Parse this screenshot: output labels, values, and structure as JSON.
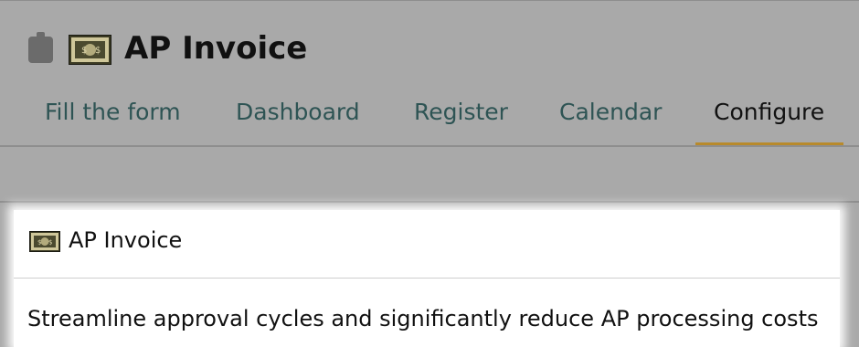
{
  "app": {
    "title": "AP Invoice"
  },
  "tabs": [
    {
      "label": "Fill the form",
      "active": false
    },
    {
      "label": "Dashboard",
      "active": false
    },
    {
      "label": "Register",
      "active": false
    },
    {
      "label": "Calendar",
      "active": false
    },
    {
      "label": "Configure",
      "active": true
    }
  ],
  "card": {
    "title": "AP Invoice",
    "description": "Streamline approval cycles and significantly reduce AP processing costs"
  },
  "icons": {
    "app_icon": "clipboard-icon",
    "brand_icon": "money-icon",
    "card_icon": "money-icon"
  },
  "colors": {
    "overlay_background": "#a9a9a9",
    "tab_text": "#2e5454",
    "active_tab_underline": "#b88a2c",
    "card_background": "#ffffff"
  }
}
